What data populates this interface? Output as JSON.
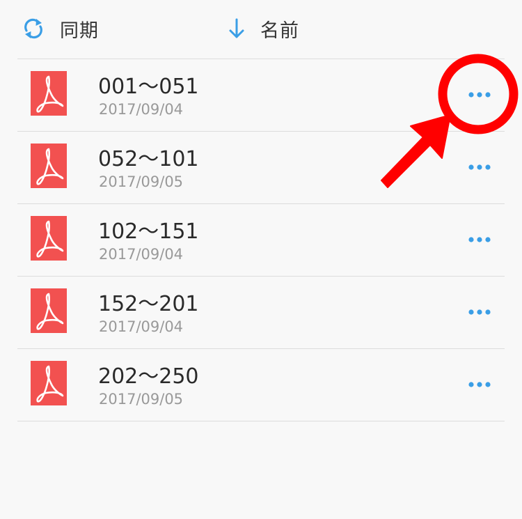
{
  "toolbar": {
    "sync_label": "同期",
    "sort_label": "名前",
    "sync_icon": "sync-icon",
    "sort_icon": "arrow-down-icon",
    "accent_color": "#3a9ee6"
  },
  "files": [
    {
      "name": "001〜051",
      "date": "2017/09/04",
      "icon": "pdf-icon"
    },
    {
      "name": "052〜101",
      "date": "2017/09/05",
      "icon": "pdf-icon"
    },
    {
      "name": "102〜151",
      "date": "2017/09/04",
      "icon": "pdf-icon"
    },
    {
      "name": "152〜201",
      "date": "2017/09/04",
      "icon": "pdf-icon"
    },
    {
      "name": "202〜250",
      "date": "2017/09/05",
      "icon": "pdf-icon"
    }
  ],
  "colors": {
    "pdf_red": "#f25150",
    "annotation_red": "#ff0000",
    "more_dots": "#3a9ee6"
  }
}
